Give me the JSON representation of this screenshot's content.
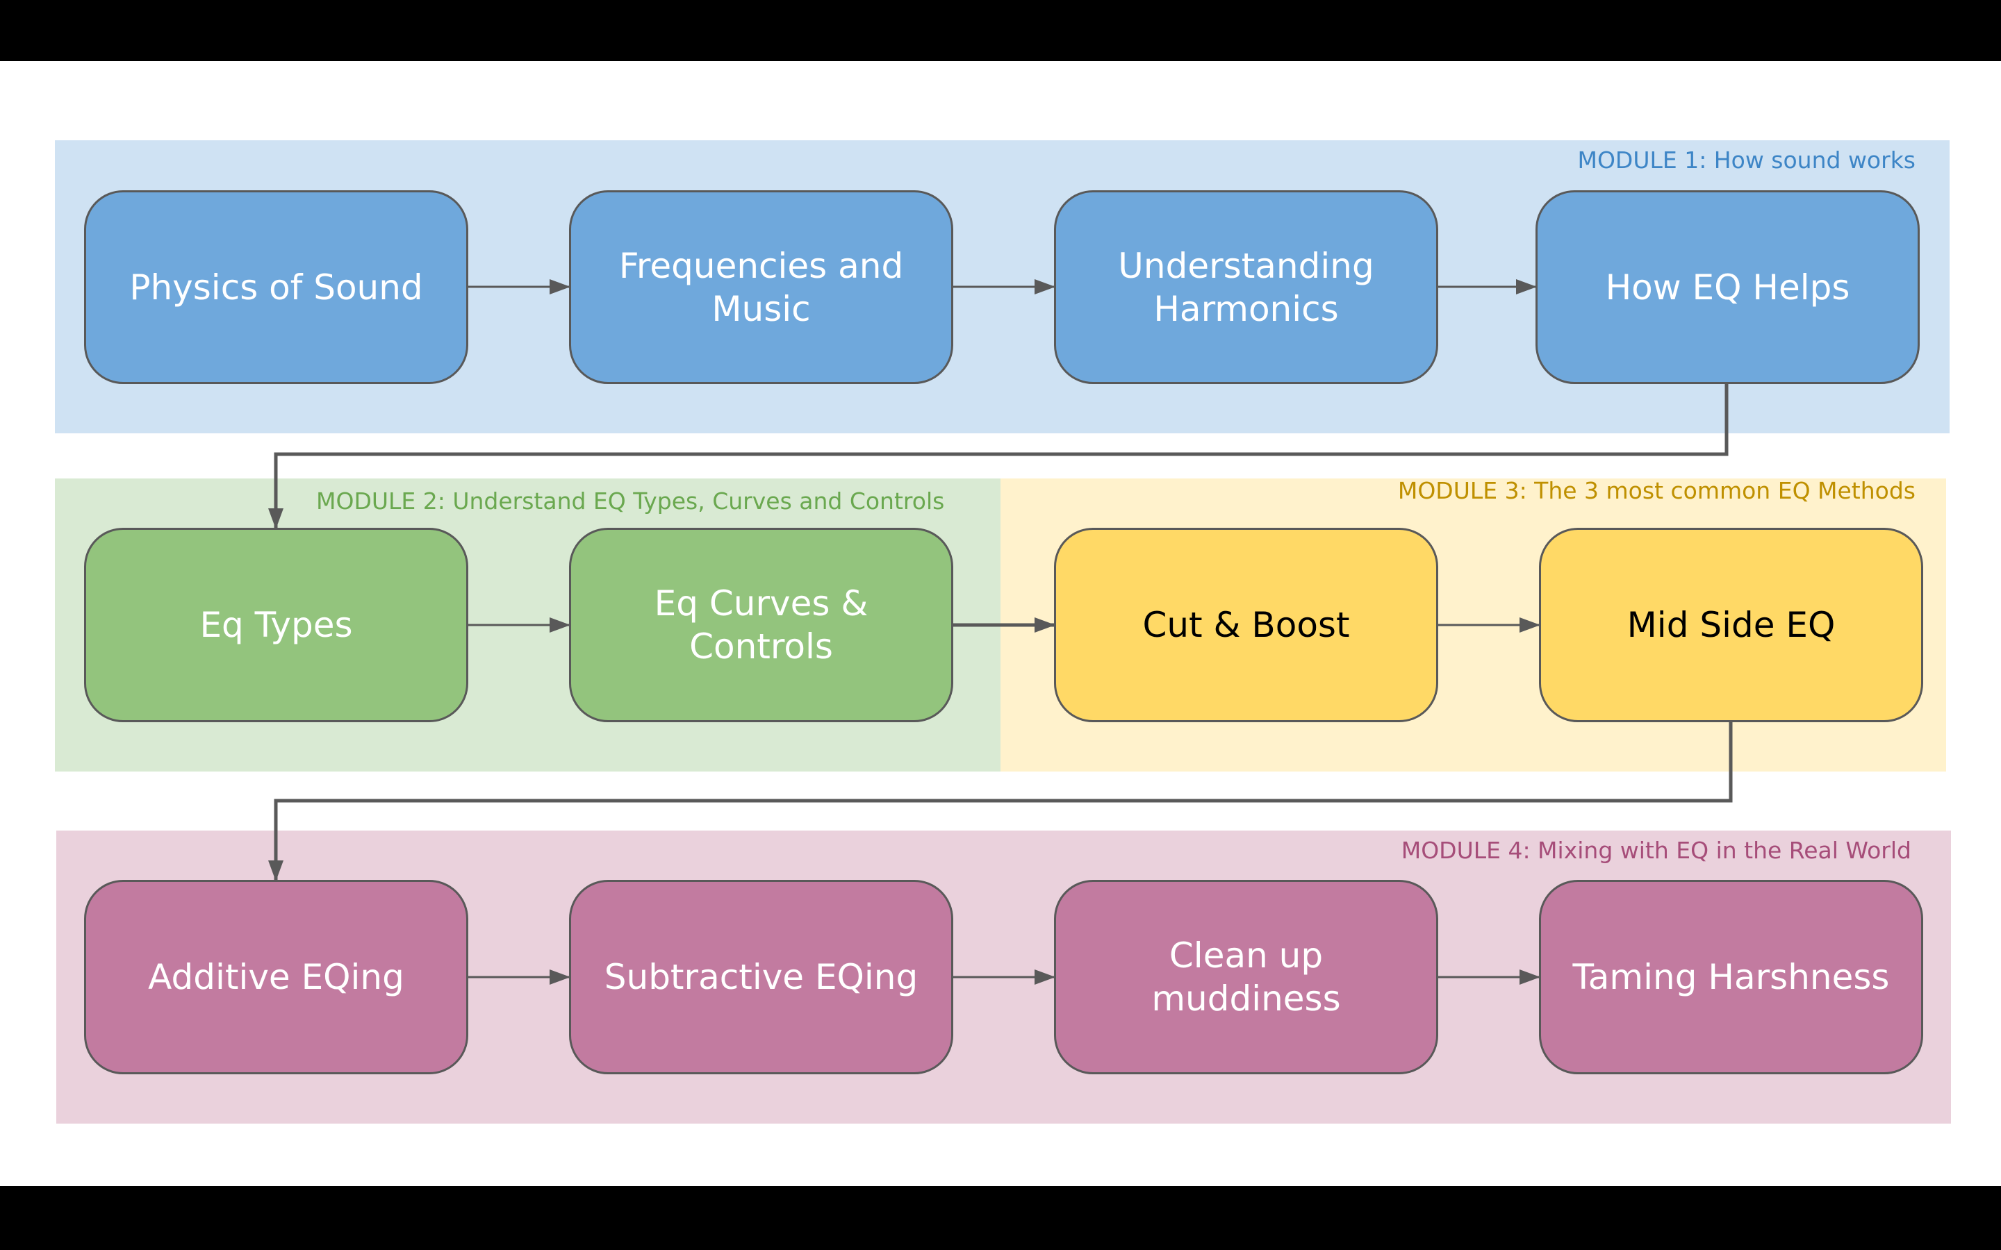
{
  "colors": {
    "m1_bg": "#cfe2f3",
    "m1_box": "#6fa8dc",
    "m1_label": "#3d85c6",
    "m2_bg": "#d9ead3",
    "m2_box": "#93c47d",
    "m2_label": "#6aa84f",
    "m3_bg": "#fff2cc",
    "m3_box": "#ffd966",
    "m3_label": "#bf9000",
    "m4_bg": "#ead1dc",
    "m4_box": "#c27ba0",
    "m4_label": "#a64d79",
    "connector": "#595959"
  },
  "modules": [
    {
      "label": "MODULE 1: How sound works",
      "steps": [
        "Physics of Sound",
        "Frequencies and Music",
        "Understanding Harmonics",
        "How EQ Helps"
      ]
    },
    {
      "label": "MODULE 2: Understand EQ Types, Curves and Controls",
      "steps": [
        "Eq Types",
        "Eq Curves & Controls"
      ]
    },
    {
      "label": "MODULE 3: The 3 most common EQ Methods",
      "steps": [
        "Cut & Boost",
        "Mid Side EQ"
      ]
    },
    {
      "label": "MODULE 4: Mixing with EQ in the Real World",
      "steps": [
        "Additive EQing",
        "Subtractive EQing",
        "Clean up muddiness",
        "Taming Harshness"
      ]
    }
  ]
}
